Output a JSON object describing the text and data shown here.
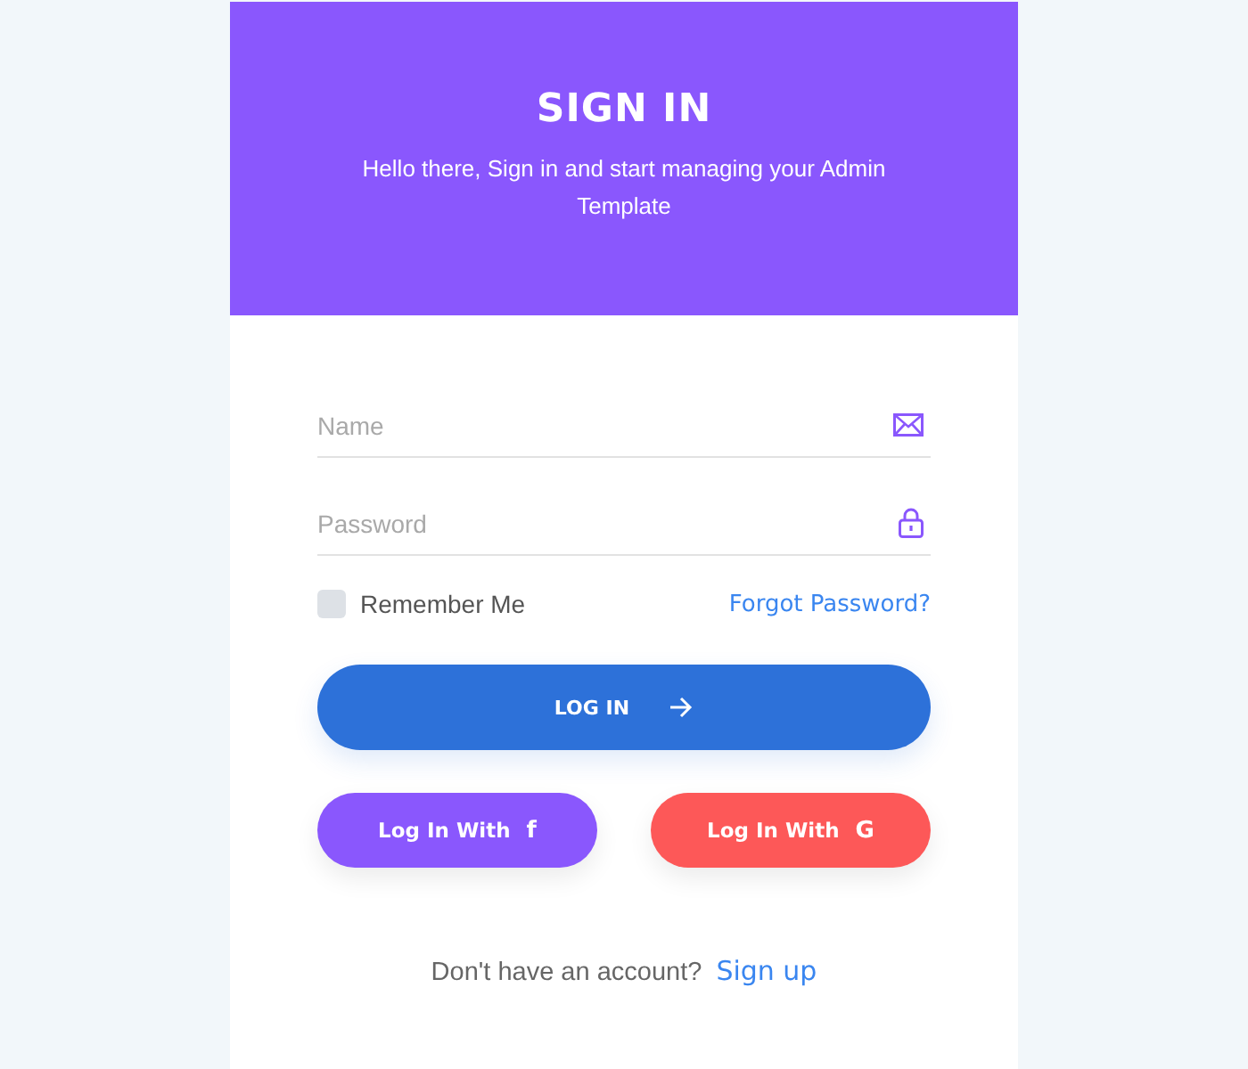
{
  "header": {
    "title": "SIGN IN",
    "subtitle": "Hello there, Sign in and start managing your Admin Template"
  },
  "fields": [
    {
      "placeholder": "Name",
      "kind": "mail"
    },
    {
      "placeholder": "Password",
      "kind": "lock"
    }
  ],
  "remember": {
    "label": "Remember Me",
    "checked": false
  },
  "forgot": "Forgot Password?",
  "login": {
    "label": "LOG IN"
  },
  "social": [
    {
      "label": "Log In With",
      "glyph": "f",
      "color": "#8a57fd"
    },
    {
      "label": "Log In With",
      "glyph": "G",
      "color": "#fd5858"
    }
  ],
  "signup": {
    "text": "Don't have an account?",
    "link": "Sign up"
  }
}
